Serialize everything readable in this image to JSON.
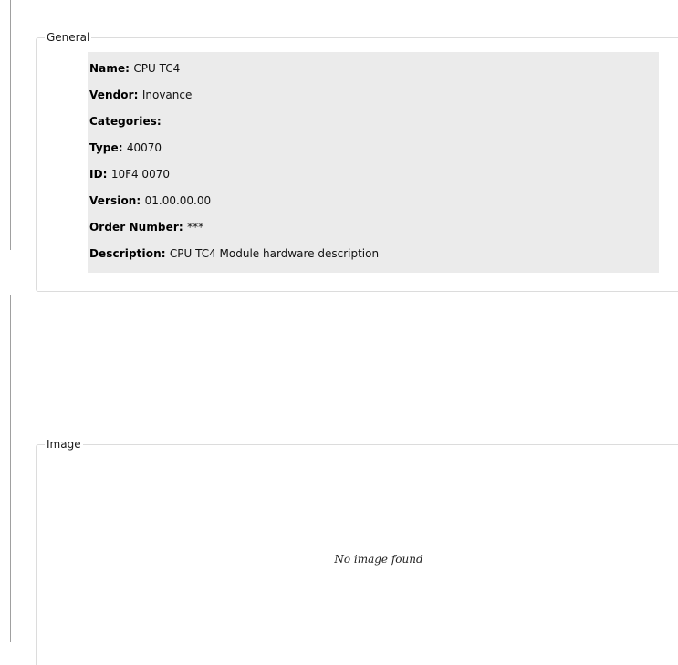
{
  "general": {
    "title": "General",
    "fields": [
      {
        "label": "Name:",
        "value": "CPU TC4"
      },
      {
        "label": "Vendor:",
        "value": "Inovance"
      },
      {
        "label": "Categories:",
        "value": ""
      },
      {
        "label": "Type:",
        "value": "40070"
      },
      {
        "label": "ID:",
        "value": "10F4 0070"
      },
      {
        "label": "Version:",
        "value": "01.00.00.00"
      },
      {
        "label": "Order Number:",
        "value": "***"
      },
      {
        "label": "Description:",
        "value": "CPU TC4 Module hardware description"
      }
    ]
  },
  "image": {
    "title": "Image",
    "placeholder": "No image found"
  },
  "colors": {
    "panel_background": "#ebebeb",
    "group_border": "#dcdcdc"
  }
}
